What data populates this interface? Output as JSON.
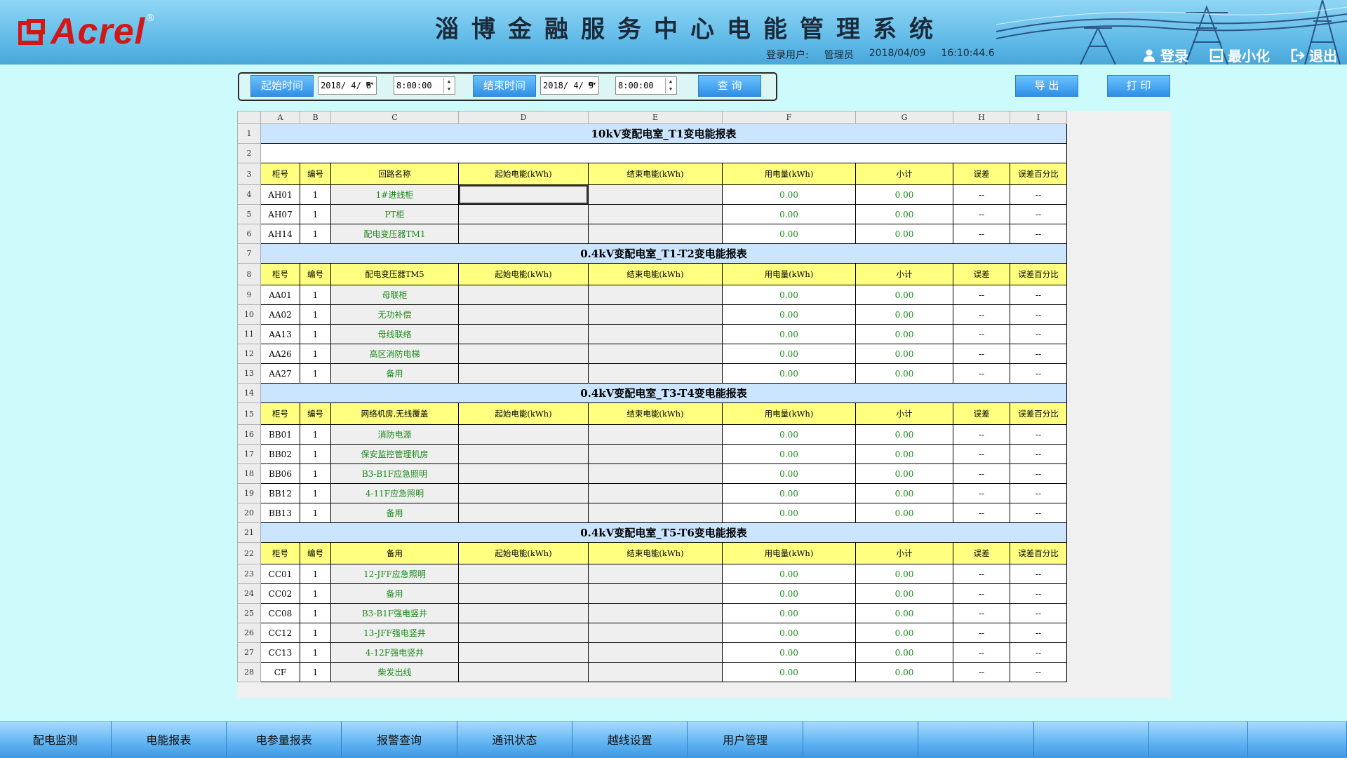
{
  "header": {
    "logo_text": "Acrel",
    "logo_reg": "®",
    "system_title": "淄博金融服务中心电能管理系统",
    "user_label": "登录用户:",
    "user_name": "管理员",
    "date": "2018/04/09",
    "time": "16:10:44.6",
    "login_label": "登录",
    "minimize_label": "最小化",
    "exit_label": "退出"
  },
  "query": {
    "start_label": "起始时间",
    "start_date": "2018/ 4/ 8",
    "start_time": "8:00:00",
    "end_label": "结束时间",
    "end_date": "2018/ 4/ 9",
    "end_time": "8:00:00",
    "search_label": "查 询",
    "export_label": "导 出",
    "print_label": "打 印"
  },
  "sheet": {
    "columns": [
      "A",
      "B",
      "C",
      "D",
      "E",
      "F",
      "G",
      "H",
      "I"
    ],
    "header_fields": [
      "柜号",
      "编号",
      "起始电能(kWh)",
      "结束电能(kWh)",
      "用电量(kWh)",
      "小计",
      "误差",
      "误差百分比"
    ],
    "blank_value": "0.00",
    "dash": "--",
    "sections": [
      {
        "title": "10kV变配电室_T1变电能报表",
        "title_row": 1,
        "blank_row": 2,
        "header_row": 3,
        "header_name": "回路名称",
        "rows": [
          {
            "n": 4,
            "code": "AH01",
            "no": "1",
            "name": "1#进线柜"
          },
          {
            "n": 5,
            "code": "AH07",
            "no": "1",
            "name": "PT柜"
          },
          {
            "n": 6,
            "code": "AH14",
            "no": "1",
            "name": "配电变压器TM1"
          }
        ]
      },
      {
        "title": "0.4kV变配电室_T1-T2变电能报表",
        "title_row": 7,
        "header_row": 8,
        "header_name": "配电变压器TM5",
        "rows": [
          {
            "n": 9,
            "code": "AA01",
            "no": "1",
            "name": "母联柜"
          },
          {
            "n": 10,
            "code": "AA02",
            "no": "1",
            "name": "无功补偿"
          },
          {
            "n": 11,
            "code": "AA13",
            "no": "1",
            "name": "母线联络"
          },
          {
            "n": 12,
            "code": "AA26",
            "no": "1",
            "name": "高区消防电梯"
          },
          {
            "n": 13,
            "code": "AA27",
            "no": "1",
            "name": "备用"
          }
        ]
      },
      {
        "title": "0.4kV变配电室_T3-T4变电能报表",
        "title_row": 14,
        "header_row": 15,
        "header_name": "网络机房,无线覆盖",
        "rows": [
          {
            "n": 16,
            "code": "BB01",
            "no": "1",
            "name": "消防电源"
          },
          {
            "n": 17,
            "code": "BB02",
            "no": "1",
            "name": "保安监控管理机房"
          },
          {
            "n": 18,
            "code": "BB06",
            "no": "1",
            "name": "B3-B1F应急照明"
          },
          {
            "n": 19,
            "code": "BB12",
            "no": "1",
            "name": "4-11F应急照明"
          },
          {
            "n": 20,
            "code": "BB13",
            "no": "1",
            "name": "备用"
          }
        ]
      },
      {
        "title": "0.4kV变配电室_T5-T6变电能报表",
        "title_row": 21,
        "header_row": 22,
        "header_name": "备用",
        "rows": [
          {
            "n": 23,
            "code": "CC01",
            "no": "1",
            "name": "12-JFF应急照明"
          },
          {
            "n": 24,
            "code": "CC02",
            "no": "1",
            "name": "备用"
          },
          {
            "n": 25,
            "code": "CC08",
            "no": "1",
            "name": "B3-B1F强电竖井"
          },
          {
            "n": 26,
            "code": "CC12",
            "no": "1",
            "name": "13-JFF强电竖井"
          },
          {
            "n": 27,
            "code": "CC13",
            "no": "1",
            "name": "4-12F强电竖井"
          },
          {
            "n": 28,
            "code": "CF",
            "no": "1",
            "name": "柴发出线"
          }
        ]
      }
    ]
  },
  "nav": {
    "items": [
      "配电监测",
      "电能报表",
      "电参量报表",
      "报警查询",
      "通讯状态",
      "越线设置",
      "用户管理",
      "",
      "",
      "",
      "",
      ""
    ]
  },
  "colors": {
    "title_row": "#cbe5ff",
    "header_row": "#ffff80",
    "green_text": "#1a8a1a",
    "logo_red": "#d01818"
  }
}
